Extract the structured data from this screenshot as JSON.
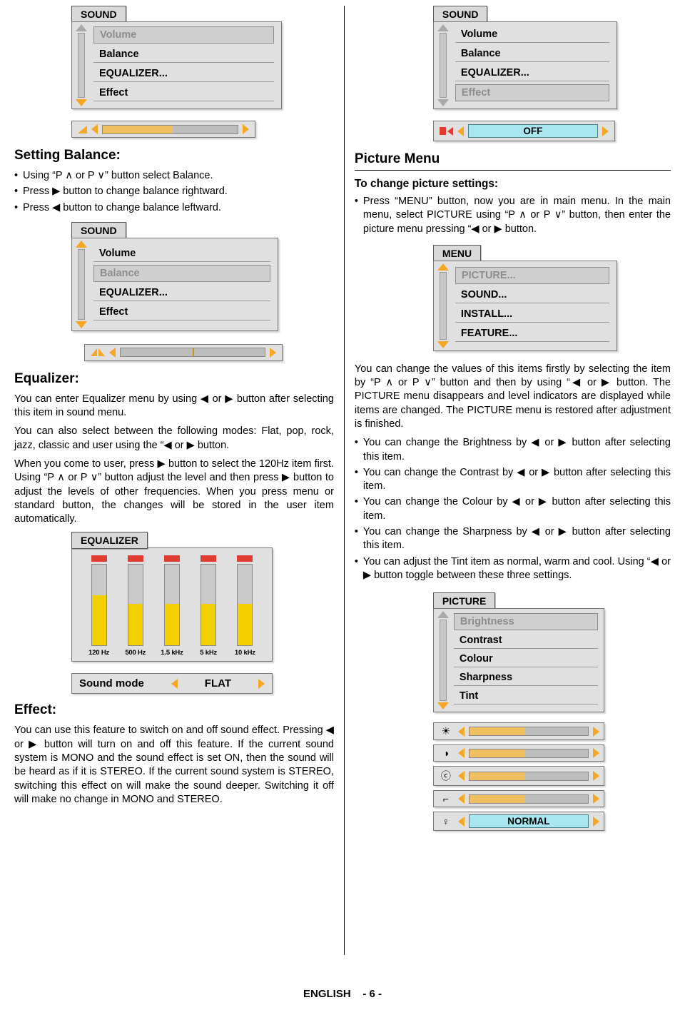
{
  "top_left_menu": {
    "tab": "SOUND",
    "items": [
      "Volume",
      "Balance",
      "EQUALIZER...",
      "Effect"
    ],
    "selected_index": 0,
    "slider": {
      "fill_percent": 52,
      "type": "balance"
    }
  },
  "top_right_menu": {
    "tab": "SOUND",
    "items": [
      "Volume",
      "Balance",
      "EQUALIZER...",
      "Effect"
    ],
    "selected_index": 3,
    "value_label": "OFF"
  },
  "balance_section": {
    "title": "Setting Balance:",
    "bullets": [
      "Using “P ∧ or P ∨” button select Balance.",
      "Press ▶ button to change balance rightward.",
      "Press ◀ button to change balance leftward."
    ],
    "menu": {
      "tab": "SOUND",
      "items": [
        "Volume",
        "Balance",
        "EQUALIZER...",
        "Effect"
      ],
      "selected_index": 1,
      "slider": {
        "mark_percent": 50
      }
    }
  },
  "equalizer_section": {
    "title": "Equalizer:",
    "paragraphs": [
      "You can enter Equalizer menu by using ◀ or ▶ button after selecting this item in sound menu.",
      "You can also select between the following modes: Flat, pop, rock, jazz, classic and user using the “◀ or ▶ button.",
      "When you come to user, press ▶ button to select the 120Hz item first. Using “P ∧ or P ∨” button adjust the level and then press ▶ button to adjust the levels of other frequencies. When you press menu or standard button, the changes will be stored in the user item automatically."
    ],
    "graphic": {
      "tab": "EQUALIZER",
      "bands": [
        {
          "label": "120 Hz",
          "level": 62
        },
        {
          "label": "500 Hz",
          "level": 52
        },
        {
          "label": "1.5 kHz",
          "level": 52
        },
        {
          "label": "5 kHz",
          "level": 52
        },
        {
          "label": "10 kHz",
          "level": 52
        }
      ],
      "sound_mode_label": "Sound mode",
      "sound_mode_value": "FLAT"
    }
  },
  "effect_section": {
    "title": "Effect:",
    "body": "You can use this feature to switch on and off sound effect. Pressing ◀ or ▶ button will turn on and off this feature. If the current sound system is MONO and the sound effect is set ON, then the sound will be heard as if it is STEREO. If the current sound system is STEREO, switching this effect on will make the sound deeper. Switching it off will make no change in MONO and STEREO."
  },
  "picture_menu": {
    "title": "Picture Menu",
    "subtitle": "To change picture settings:",
    "bullet": "Press “MENU” button, now you are in main menu. In the main menu, select PICTURE using “P ∧ or P ∨” button, then enter the picture menu pressing “◀ or ▶ button.",
    "main_menu": {
      "tab": "MENU",
      "items": [
        "PICTURE...",
        "SOUND...",
        "INSTALL...",
        "FEATURE..."
      ],
      "selected_index": 0
    },
    "body": "You can change the values of this items firstly by selecting the item by “P ∧ or P ∨” button and then by using “◀ or ▶ button. The PICTURE menu disappears and level indicators are displayed while items are changed. The PICTURE menu is restored after adjustment is finished.",
    "bullets": [
      "You can change the Brightness by ◀ or ▶ button after selecting this item.",
      "You can change the Contrast by ◀ or ▶ button after selecting this item.",
      "You can change the Colour by ◀ or ▶ button after selecting this item.",
      "You can change the Sharpness by ◀ or ▶ button after selecting this item.",
      "You can adjust the Tint item as normal, warm and cool. Using “◀ or ▶ button toggle between these three settings."
    ],
    "picture_osd": {
      "tab": "PICTURE",
      "items": [
        "Brightness",
        "Contrast",
        "Colour",
        "Sharpness",
        "Tint"
      ],
      "selected_index": 0,
      "sliders": [
        {
          "icon": "brightness-icon",
          "glyph": "☀",
          "fill_percent": 47
        },
        {
          "icon": "contrast-icon",
          "glyph": "◑",
          "fill_percent": 47
        },
        {
          "icon": "colour-icon",
          "glyph": "ⓒ",
          "fill_percent": 47
        },
        {
          "icon": "sharpness-icon",
          "glyph": "⌐",
          "fill_percent": 47
        }
      ],
      "tint_row": {
        "icon": "tint-icon",
        "glyph": "♀",
        "value": "NORMAL"
      }
    }
  },
  "footer": {
    "language": "ENGLISH",
    "page": "- 6 -"
  },
  "colors": {
    "osd_background": "#e0e0e0",
    "osd_tab": "#d9d9d9",
    "accent_orange": "#f5a623",
    "value_box": "#a8e6f0",
    "eq_bar": "#f5d000",
    "eq_cap": "#e03c31"
  }
}
